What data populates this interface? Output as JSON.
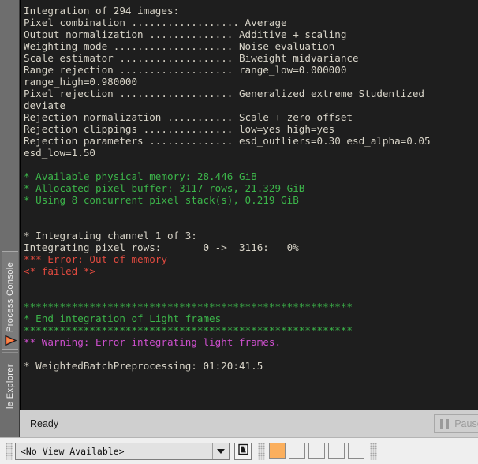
{
  "tabs": [
    {
      "label": "Process Console",
      "icon": "play-triangle-icon",
      "selected": true
    },
    {
      "label": "File Explorer",
      "icon": "bucket-icon",
      "selected": false
    }
  ],
  "console": {
    "lines": [
      {
        "text": "Integration of 294 images:",
        "color": "default"
      },
      {
        "text": "Pixel combination .................. Average",
        "color": "default"
      },
      {
        "text": "Output normalization .............. Additive + scaling",
        "color": "default"
      },
      {
        "text": "Weighting mode .................... Noise evaluation",
        "color": "default"
      },
      {
        "text": "Scale estimator ................... Biweight midvariance",
        "color": "default"
      },
      {
        "text": "Range rejection ................... range_low=0.000000",
        "color": "default"
      },
      {
        "text": "range_high=0.980000",
        "color": "default"
      },
      {
        "text": "Pixel rejection ................... Generalized extreme Studentized",
        "color": "default"
      },
      {
        "text": "deviate",
        "color": "default"
      },
      {
        "text": "Rejection normalization ........... Scale + zero offset",
        "color": "default"
      },
      {
        "text": "Rejection clippings ............... low=yes high=yes",
        "color": "default"
      },
      {
        "text": "Rejection parameters .............. esd_outliers=0.30 esd_alpha=0.05",
        "color": "default"
      },
      {
        "text": "esd_low=1.50",
        "color": "default"
      },
      {
        "text": "",
        "color": "default"
      },
      {
        "text": "* Available physical memory: 28.446 GiB",
        "color": "green"
      },
      {
        "text": "* Allocated pixel buffer: 3117 rows, 21.329 GiB",
        "color": "green"
      },
      {
        "text": "* Using 8 concurrent pixel stack(s), 0.219 GiB",
        "color": "green"
      },
      {
        "text": "",
        "color": "default"
      },
      {
        "text": "",
        "color": "default"
      },
      {
        "text": "* Integrating channel 1 of 3:",
        "color": "default"
      },
      {
        "text": "Integrating pixel rows:       0 ->  3116:   0%",
        "color": "default"
      },
      {
        "text": "*** Error: Out of memory",
        "color": "red"
      },
      {
        "text": "<* failed *>",
        "color": "red"
      },
      {
        "text": "",
        "color": "default"
      },
      {
        "text": "",
        "color": "default"
      },
      {
        "text": "*******************************************************",
        "color": "green"
      },
      {
        "text": "* End integration of Light frames",
        "color": "green"
      },
      {
        "text": "*******************************************************",
        "color": "green"
      },
      {
        "text": "** Warning: Error integrating light frames.",
        "color": "magenta"
      },
      {
        "text": "",
        "color": "default"
      },
      {
        "text": "* WeightedBatchPreprocessing: 01:20:41.5",
        "color": "default"
      }
    ],
    "colors": {
      "default": "#d8d4c8",
      "green": "#3cb54a",
      "red": "#e04a3f",
      "magenta": "#cc4fcc",
      "background": "#1e1e1e"
    }
  },
  "statusbar": {
    "status_text": "Ready",
    "pause_button_label": "Pause/Abort"
  },
  "bottombar": {
    "view_selector_value": "<No View Available>",
    "swatch_colors": [
      "#fbaf5d",
      "#efefef",
      "#efefef",
      "#efefef",
      "#efefef"
    ],
    "accent_color": "#fbaf5d"
  }
}
